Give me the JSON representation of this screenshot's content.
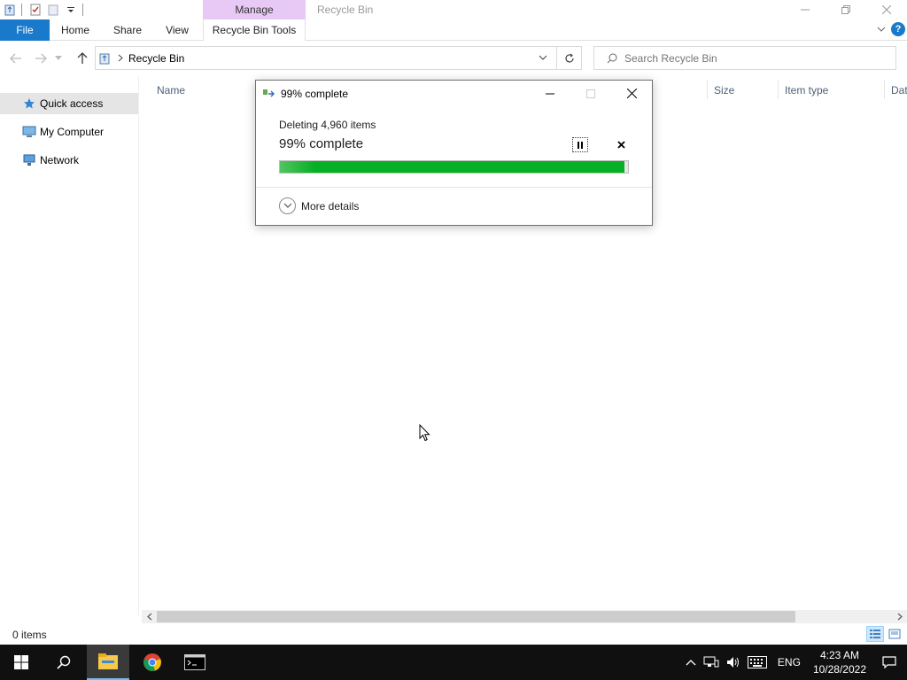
{
  "window": {
    "title": "Recycle Bin",
    "context_tab": "Manage"
  },
  "ribbon": {
    "tabs": [
      "File",
      "Home",
      "Share",
      "View",
      "Recycle Bin Tools"
    ]
  },
  "address": {
    "crumb": "Recycle Bin"
  },
  "search": {
    "placeholder": "Search Recycle Bin"
  },
  "nav": {
    "items": [
      {
        "label": "Quick access",
        "icon": "star-icon",
        "selected": true
      },
      {
        "label": "My Computer",
        "icon": "computer-icon",
        "selected": false
      },
      {
        "label": "Network",
        "icon": "network-icon",
        "selected": false
      }
    ]
  },
  "columns": [
    "Name",
    "Size",
    "Item type",
    "Dat"
  ],
  "status": {
    "item_count": "0 items"
  },
  "dialog": {
    "title": "99% complete",
    "subtitle": "Deleting 4,960 items",
    "percent_label": "99% complete",
    "progress": 0.99,
    "more_details": "More details"
  },
  "taskbar": {
    "apps": [
      "start-icon",
      "search-icon",
      "file-explorer-icon",
      "chrome-icon",
      "terminal-icon"
    ],
    "language": "ENG",
    "time": "4:23 AM",
    "date": "10/28/2022"
  },
  "colors": {
    "accent": "#1979ca",
    "progress_green": "#06b025",
    "manage_tab": "#e8c8f4"
  }
}
